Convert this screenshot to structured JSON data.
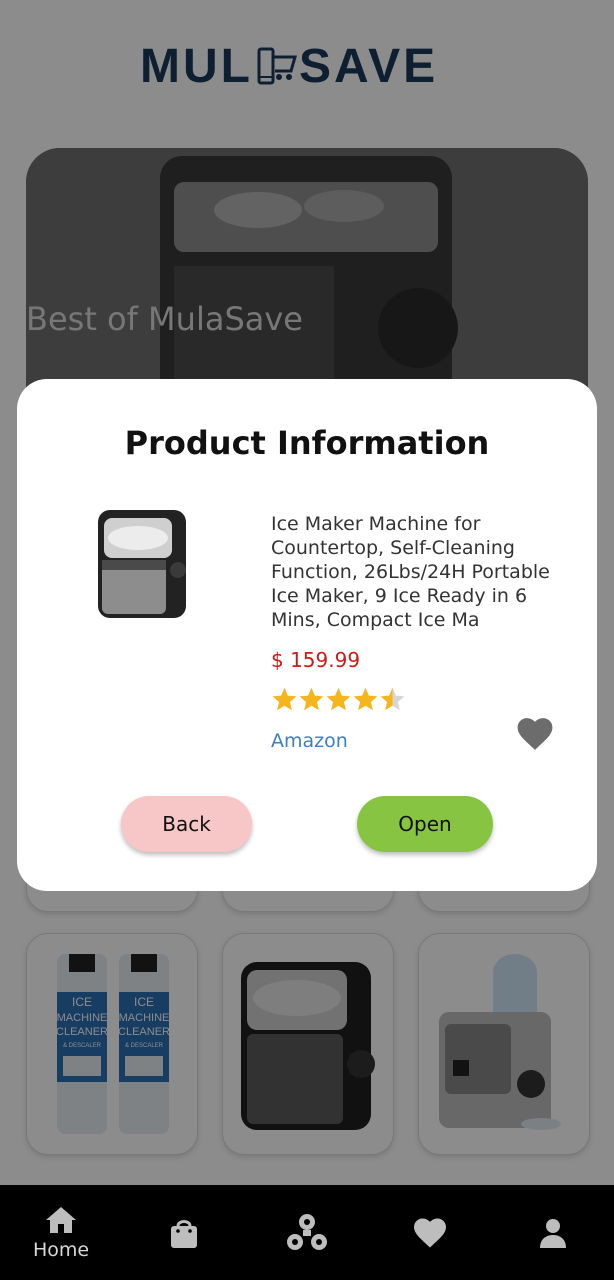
{
  "app": {
    "logo_text_left": "MUL",
    "logo_text_right": "SAVE",
    "hero_title": "Best of MulaSave"
  },
  "dialog": {
    "title": "Product Information",
    "product_name": "Ice Maker Machine for Countertop, Self-Cleaning Function, 26Lbs/24H Portable Ice Maker, 9 Ice Ready in 6 Mins, Compact Ice Ma",
    "price": "$ 159.99",
    "rating": 4.5,
    "rating_max": 5,
    "store": "Amazon",
    "back_label": "Back",
    "open_label": "Open"
  },
  "products_row": [
    {
      "name": "ice-machine-cleaner",
      "label_line1": "ICE",
      "label_line2": "MACHINE",
      "label_line3": "CLEANER",
      "label_line4": "& DESCALER"
    },
    {
      "name": "ice-maker-black"
    },
    {
      "name": "ice-maker-water-jug"
    }
  ],
  "bottom_nav": {
    "home_label": "Home",
    "items": [
      "home-icon",
      "shopping-bag-icon",
      "community-icon",
      "heart-icon",
      "profile-icon"
    ]
  },
  "colors": {
    "brand": "#1d3a5c",
    "price": "#cc1a1a",
    "link": "#3d7fc4",
    "back_button": "#f7c6c6",
    "open_button": "#86c442",
    "star": "#f5b51c"
  }
}
